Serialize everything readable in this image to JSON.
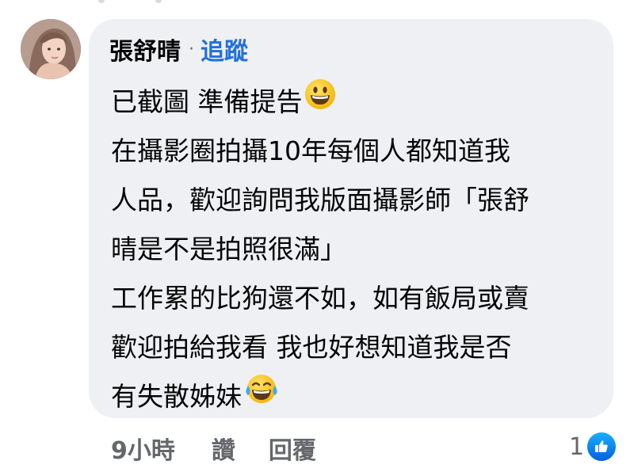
{
  "comment": {
    "author_name": "張舒晴",
    "separator": "·",
    "follow_label": "追蹤",
    "lines": [
      "已截圖 準備提告",
      "在攝影圈拍攝10年每個人都知道我",
      "人品，歡迎詢問我版面攝影師「張舒",
      "晴是不是拍照很滿」",
      "工作累的比狗還不如，如有飯局或賣",
      "歡迎拍給我看 我也好想知道我是否",
      "有失散姊妹"
    ],
    "emojis": {
      "line1": "grinning-face",
      "line7": "face-with-tears-of-joy"
    }
  },
  "footer": {
    "time": "9小時",
    "like_label": "讚",
    "reply_label": "回覆"
  },
  "reactions": {
    "count": "1",
    "icon": "like-icon"
  },
  "colors": {
    "bubble": "#eef0f3",
    "link": "#216fdb",
    "meta": "#65676b",
    "like_badge": "#1877f2"
  }
}
